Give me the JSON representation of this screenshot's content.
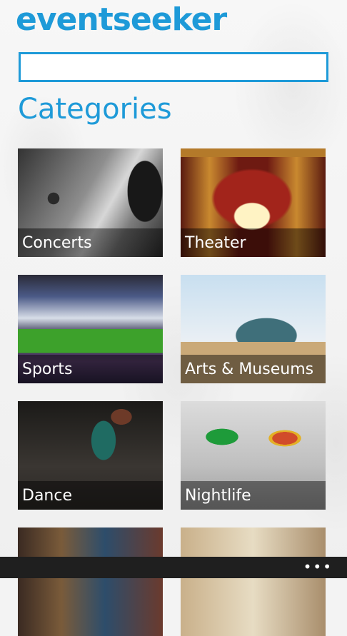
{
  "app": {
    "title": "eventseeker"
  },
  "search": {
    "value": "",
    "placeholder": ""
  },
  "section": {
    "title": "Categories"
  },
  "categories": [
    {
      "label": "Concerts"
    },
    {
      "label": "Theater"
    },
    {
      "label": "Sports"
    },
    {
      "label": "Arts & Museums"
    },
    {
      "label": "Dance"
    },
    {
      "label": "Nightlife"
    }
  ],
  "appbar": {
    "more_icon": "more-dots-icon",
    "more_label": "•••"
  }
}
